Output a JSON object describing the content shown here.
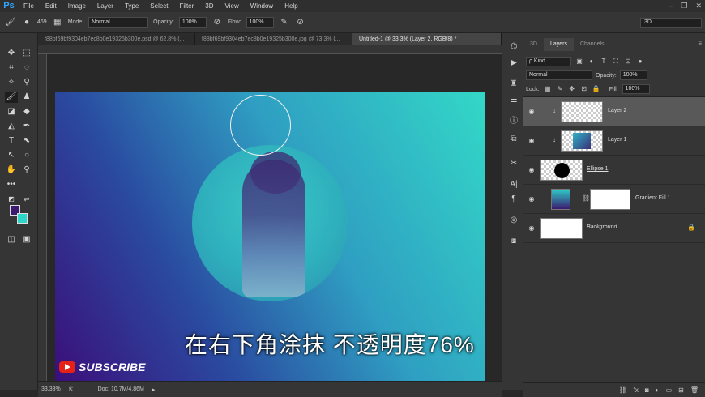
{
  "app": {
    "logo": "Ps"
  },
  "menu": [
    "File",
    "Edit",
    "Image",
    "Layer",
    "Type",
    "Select",
    "Filter",
    "3D",
    "View",
    "Window",
    "Help"
  ],
  "window_controls": [
    "–",
    "❐",
    "✕"
  ],
  "options_bar": {
    "brush_size": "469",
    "mode_label": "Mode:",
    "mode_value": "Normal",
    "opacity_label": "Opacity:",
    "opacity_value": "100%",
    "flow_label": "Flow:",
    "flow_value": "100%",
    "workspace": "3D"
  },
  "doc_tabs": [
    {
      "label": "f88bf69bf9304eb7ec8b0e19325b300e.psd @ 62.8% (...",
      "active": false
    },
    {
      "label": "f88bf69bf9304eb7ec8b0e19325b300e.jpg @ 73.3% (...",
      "active": false
    },
    {
      "label": "Untitled-1 @ 33.3% (Layer 2, RGB/8) *",
      "active": true
    }
  ],
  "status": {
    "zoom": "33.33%",
    "doc_size": "Doc: 10.7M/4.86M"
  },
  "overlay": {
    "subtitle": "在右下角涂抹 不透明度76%",
    "subscribe": "SUBSCRIBE"
  },
  "panel": {
    "tabs": [
      "3D",
      "Layers",
      "Channels"
    ],
    "active_tab": "Layers",
    "kind_label": "ρ Kind",
    "blend_mode": "Normal",
    "opacity_label": "Opacity:",
    "opacity_value": "100%",
    "lock_label": "Lock:",
    "fill_label": "Fill:",
    "fill_value": "100%",
    "layers": [
      {
        "name": "Layer 2",
        "selected": true,
        "clipped": true,
        "thumb": "transparent"
      },
      {
        "name": "Layer 1",
        "selected": false,
        "clipped": true,
        "thumb": "photo"
      },
      {
        "name": "Ellipse 1",
        "selected": false,
        "clipped": false,
        "thumb": "ellipse"
      },
      {
        "name": "Gradient Fill 1",
        "selected": false,
        "clipped": false,
        "thumb": "gradient"
      },
      {
        "name": "Background",
        "selected": false,
        "clipped": false,
        "thumb": "white",
        "italic": true,
        "locked": true
      }
    ],
    "footer_icons": [
      "link-icon",
      "fx-icon",
      "mask-icon",
      "adjustment-icon",
      "group-icon",
      "new-layer-icon",
      "trash-icon"
    ]
  },
  "colors": {
    "foreground": "#3a1a6e",
    "background": "#2ed6c8"
  }
}
